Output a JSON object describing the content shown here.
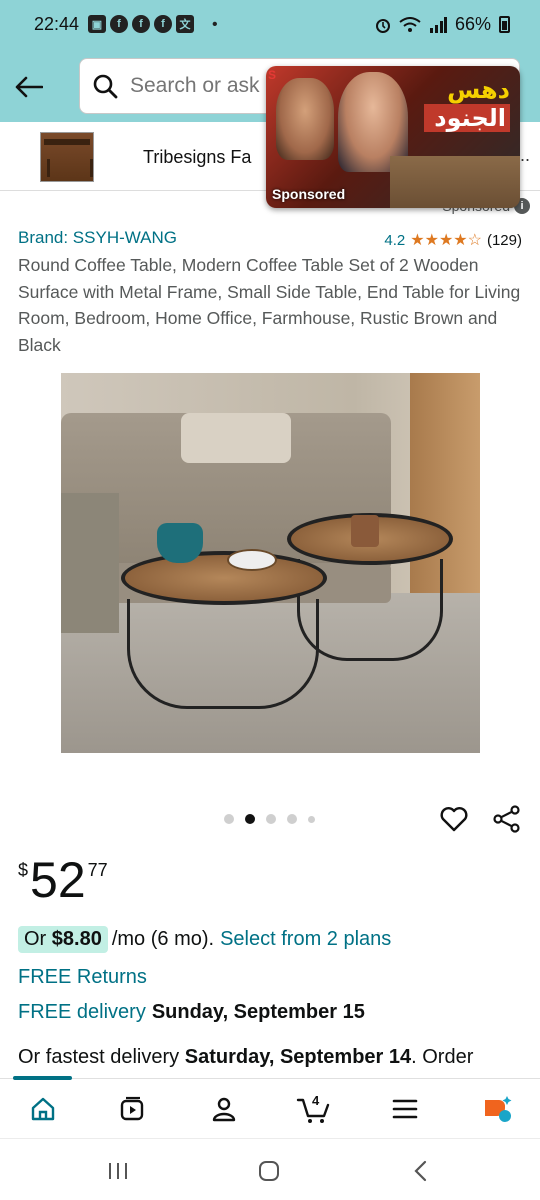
{
  "status_bar": {
    "time": "22:44",
    "notification_icons": [
      "gallery-icon",
      "facebook-icon",
      "facebook-icon",
      "facebook-icon",
      "translate-icon"
    ],
    "dot": "•",
    "battery_percent": "66%"
  },
  "header": {
    "search_placeholder": "Search or ask a question"
  },
  "sponsored_ad": {
    "brand": "Tribesigns Fa",
    "ellipsis": "...",
    "sponsored_label": "Sponsored"
  },
  "overlay_ad": {
    "title_line1": "دهس",
    "title_line2": "الجنود",
    "sponsored_label": "Sponsored",
    "close_glyph": "S"
  },
  "product": {
    "brand": "Brand: SSYH-WANG",
    "rating_value": "4.2",
    "stars": "★★★★☆",
    "rating_count": "(129)",
    "title": "Round Coffee Table, Modern Coffee Table Set of 2 Wooden Surface with Metal Frame, Small Side Table, End Table for Living Room, Bedroom, Home Office, Farmhouse, Rustic Brown and Black"
  },
  "carousel": {
    "dot_count": 5,
    "active_index": 1
  },
  "price": {
    "symbol": "$",
    "whole": "52",
    "fraction": "77"
  },
  "monthly": {
    "or_label": "Or",
    "amount": "$8.80",
    "rest": "/mo (6 mo).",
    "link": "Select from 2 plans"
  },
  "shipping": {
    "free_returns": "FREE Returns",
    "free_delivery_label": "FREE delivery",
    "free_delivery_date": "Sunday, September 15",
    "fastest_prefix": "Or fastest delivery",
    "fastest_date": "Saturday, September 14",
    "fastest_suffix": ". Order"
  },
  "bottom_nav": {
    "cart_count": "4"
  },
  "colors": {
    "header_bg": "#8ed3d6",
    "link": "#007185",
    "star": "#de7921",
    "monthly_chip": "#c2efe4"
  }
}
